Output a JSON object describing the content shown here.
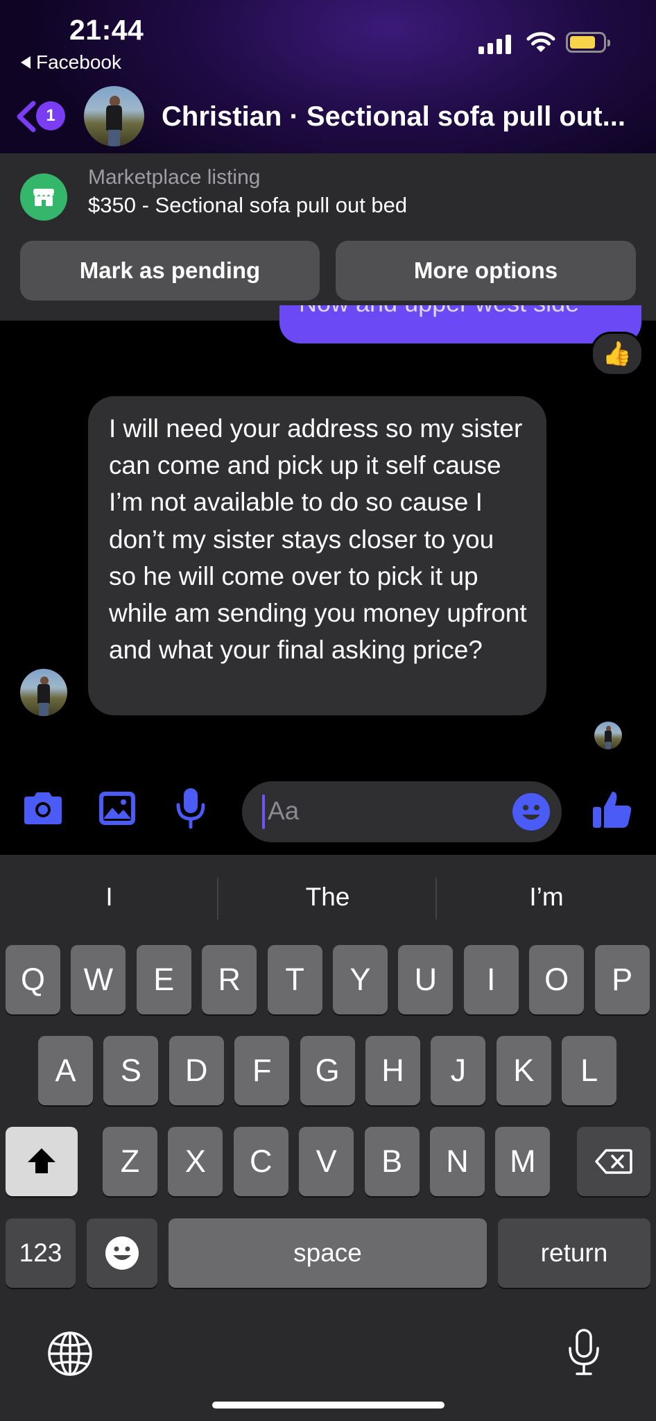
{
  "status_bar": {
    "time": "21:44",
    "back_app": "Facebook"
  },
  "header": {
    "unread_count": "1",
    "title": "Christian · Sectional sofa pull out..."
  },
  "listing": {
    "subtitle": "Marketplace listing",
    "title": "$350 - Sectional sofa pull out bed",
    "mark_pending_label": "Mark as pending",
    "more_options_label": "More options"
  },
  "messages": {
    "sent_partial": "Now and upper west side",
    "reaction": "👍",
    "received": "I will need your address so my sister can come and pick up it self cause I’m not available to do so cause I don’t my sister stays closer to you so he will come over to pick it up while am sending you money upfront and what your final asking price?"
  },
  "composer": {
    "placeholder": "Aa"
  },
  "keyboard": {
    "suggestions": [
      "I",
      "The",
      "I’m"
    ],
    "row1": [
      "Q",
      "W",
      "E",
      "R",
      "T",
      "Y",
      "U",
      "I",
      "O",
      "P"
    ],
    "row2": [
      "A",
      "S",
      "D",
      "F",
      "G",
      "H",
      "J",
      "K",
      "L"
    ],
    "row3": [
      "Z",
      "X",
      "C",
      "V",
      "B",
      "N",
      "M"
    ],
    "numbers_label": "123",
    "space_label": "space",
    "return_label": "return"
  },
  "colors": {
    "accent": "#6b49f5",
    "icon_blue": "#4a5cf5",
    "listing_green": "#34b76b",
    "battery": "#f7d44a"
  }
}
